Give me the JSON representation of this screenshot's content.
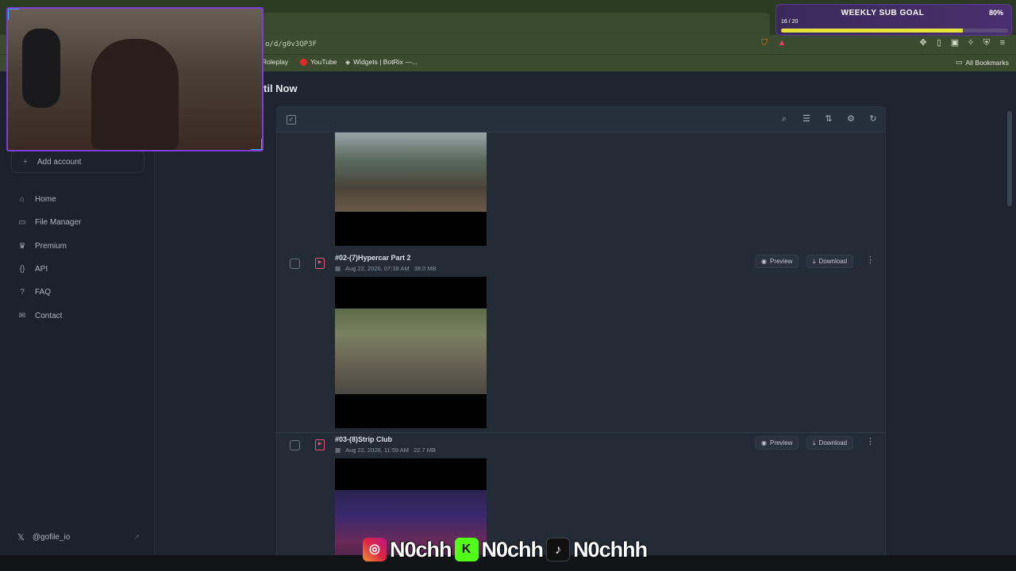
{
  "browser": {
    "url": "o/d/g0v3QP3F",
    "bookmarks": [
      {
        "label": "Roleplay",
        "color": "#9aa3b0"
      },
      {
        "label": "YouTube",
        "color": "#e02a2a"
      },
      {
        "label": "Widgets | BotRix —...",
        "color": "#dcdcdc"
      }
    ],
    "all_bookmarks": "All Bookmarks"
  },
  "page": {
    "title": "til Now"
  },
  "sidebar": {
    "add_account": "Add account",
    "items": [
      {
        "label": "Home",
        "icon": "home-icon",
        "glyph": "⌂"
      },
      {
        "label": "File Manager",
        "icon": "folder-icon",
        "glyph": "▭"
      },
      {
        "label": "Premium",
        "icon": "crown-icon",
        "glyph": "♛"
      },
      {
        "label": "API",
        "icon": "code-braces-icon",
        "glyph": "{}"
      },
      {
        "label": "FAQ",
        "icon": "help-circle-icon",
        "glyph": "?"
      },
      {
        "label": "Contact",
        "icon": "mail-icon",
        "glyph": "✉"
      }
    ],
    "twitter": "@gofile_io"
  },
  "files": [
    {
      "name": "#02-(7)Hypercar Part 2",
      "date": "Aug 22, 2026, 07:38 AM",
      "size": "38.0 MB"
    },
    {
      "name": "#03-(8)Strip Club",
      "date": "Aug 22, 2026, 11:59 AM",
      "size": "22.7 MB"
    }
  ],
  "actions": {
    "preview": "Preview",
    "download": "Download"
  },
  "overlay": {
    "goal_title": "WEEKLY SUB GOAL",
    "goal_percent": "80%",
    "goal_count": "16 / 20",
    "goal_fraction": 0.8,
    "socials": [
      {
        "platform": "instagram",
        "handle": "N0chh",
        "color": "#c2357a"
      },
      {
        "platform": "kick",
        "handle": "N0chh",
        "color": "#53fc18"
      },
      {
        "platform": "tiktok",
        "handle": "N0chhh",
        "color": "#111111"
      }
    ]
  }
}
